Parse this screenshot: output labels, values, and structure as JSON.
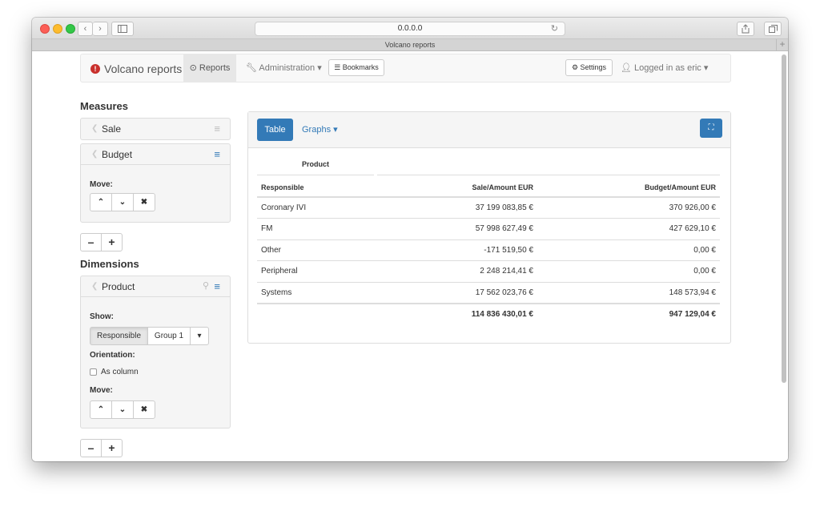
{
  "browser": {
    "address": "0.0.0.0",
    "tab_title": "Volcano reports",
    "back_icon": "‹",
    "forward_icon": "›",
    "reload_icon": "↻",
    "plus": "+"
  },
  "navbar": {
    "brand": "Volcano reports",
    "reports": "Reports",
    "administration": "Administration",
    "bookmarks": "Bookmarks",
    "settings": "Settings",
    "user": "Logged in as eric"
  },
  "measures": {
    "title": "Measures",
    "items": [
      {
        "label": "Sale"
      },
      {
        "label": "Budget"
      }
    ],
    "move_label": "Move:"
  },
  "dimensions": {
    "title": "Dimensions",
    "item": "Product",
    "show_label": "Show:",
    "show_options": [
      "Responsible",
      "Group 1"
    ],
    "orientation_label": "Orientation:",
    "as_column": "As column",
    "move_label": "Move:"
  },
  "main": {
    "tab_table": "Table",
    "tab_graphs": "Graphs",
    "dimension_header": "Product",
    "columns": [
      "Responsible",
      "Sale/Amount EUR",
      "Budget/Amount EUR"
    ],
    "rows": [
      [
        "Coronary IVI",
        "37 199 083,85 €",
        "370 926,00 €"
      ],
      [
        "FM",
        "57 998 627,49 €",
        "427 629,10 €"
      ],
      [
        "Other",
        "-171 519,50 €",
        "0,00 €"
      ],
      [
        "Peripheral",
        "2 248 214,41 €",
        "0,00 €"
      ],
      [
        "Systems",
        "17 562 023,76 €",
        "148 573,94 €"
      ]
    ],
    "totals": [
      "",
      "114 836 430,01 €",
      "947 129,04 €"
    ]
  },
  "colors": {
    "accent": "#337ab7",
    "brand_icon": "#c9302c"
  }
}
